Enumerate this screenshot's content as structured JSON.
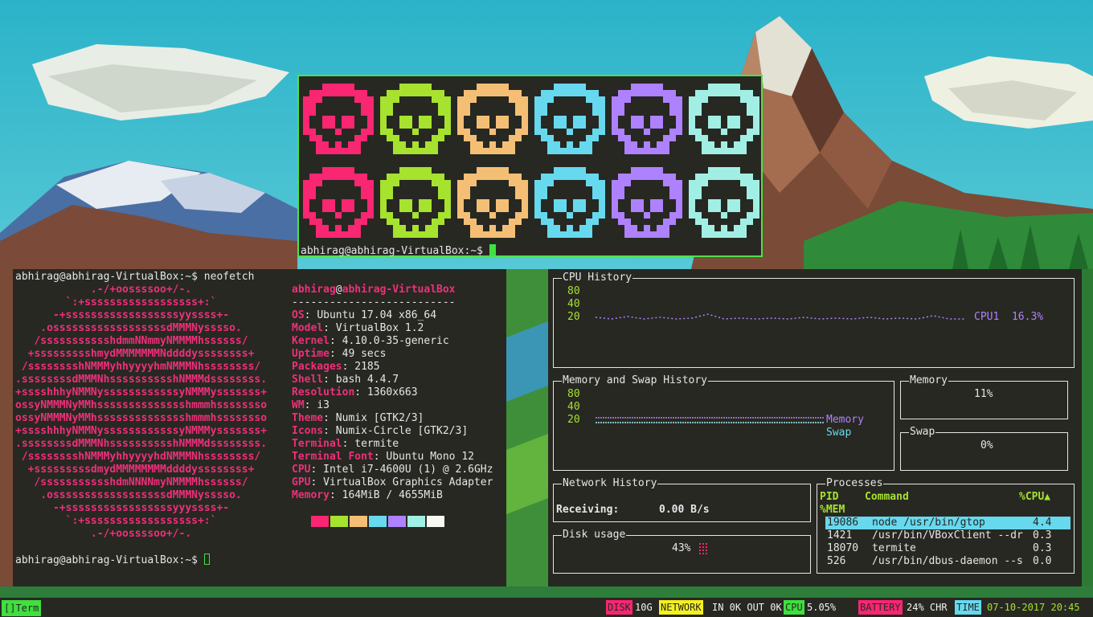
{
  "skulls": {
    "colors": [
      "#f92672",
      "#a6e22e",
      "#f4bf75",
      "#66d9ef",
      "#ae81ff",
      "#a1efe4"
    ],
    "prompt": "abhirag@abhirag-VirtualBox:~$ "
  },
  "neofetch": {
    "command_line": "abhirag@abhirag-VirtualBox:~$ neofetch",
    "user": "abhirag",
    "at": "@",
    "host": "abhirag-VirtualBox",
    "separator": "--------------------------",
    "logo_lines": [
      "            .-/+oossssoo+/-.",
      "        `:+ssssssssssssssssss+:`",
      "      -+ssssssssssssssssssyyssss+-",
      "    .ossssssssssssssssssdMMMNysssso.",
      "   /ssssssssssshdmmNNmmyNMMMMhssssss/",
      "  +ssssssssshmydMMMMMMMNddddyssssssss+",
      " /sssssssshNMMMyhhyyyyhmNMMMNhssssssss/",
      ".ssssssssdMMMNhsssssssssshNMMMdssssssss.",
      "+sssshhhyNMMNyssssssssssssyNMMMysssssss+",
      "ossyNMMMNyMMhsssssssssssssshmmmhssssssso",
      "ossyNMMMNyMMhsssssssssssssshmmmhssssssso",
      "+sssshhhyNMMNyssssssssssssyNMMMysssssss+",
      ".ssssssssdMMMNhsssssssssshNMMMdssssssss.",
      " /sssssssshNMMMyhhyyyyhdNMMMNhssssssss/",
      "  +sssssssssdmydMMMMMMMMddddyssssssss+",
      "   /ssssssssssshdmNNNNmyNMMMMhssssss/",
      "    .ossssssssssssssssssdMMMNysssso.",
      "      -+sssssssssssssssssyyyssss+-",
      "        `:+ssssssssssssssssss+:`",
      "            .-/+oossssoo+/-."
    ],
    "info": [
      {
        "key": "OS",
        "value": "Ubuntu 17.04 x86_64"
      },
      {
        "key": "Model",
        "value": "VirtualBox 1.2"
      },
      {
        "key": "Kernel",
        "value": "4.10.0-35-generic"
      },
      {
        "key": "Uptime",
        "value": "49 secs"
      },
      {
        "key": "Packages",
        "value": "2185"
      },
      {
        "key": "Shell",
        "value": "bash 4.4.7"
      },
      {
        "key": "Resolution",
        "value": "1360x663"
      },
      {
        "key": "WM",
        "value": "i3"
      },
      {
        "key": "Theme",
        "value": "Numix [GTK2/3]"
      },
      {
        "key": "Icons",
        "value": "Numix-Circle [GTK2/3]"
      },
      {
        "key": "Terminal",
        "value": "termite"
      },
      {
        "key": "Terminal Font",
        "value": "Ubuntu Mono 12"
      },
      {
        "key": "CPU",
        "value": "Intel i7-4600U (1) @ 2.6GHz"
      },
      {
        "key": "GPU",
        "value": "VirtualBox Graphics Adapter"
      },
      {
        "key": "Memory",
        "value": "164MiB / 4655MiB"
      }
    ],
    "palette": [
      "#f92672",
      "#a6e22e",
      "#f4bf75",
      "#66d9ef",
      "#ae81ff",
      "#a1efe4",
      "#f8f8f2"
    ],
    "prompt": "abhirag@abhirag-VirtualBox:~$ "
  },
  "gtop": {
    "cpu_history": {
      "title": "CPU History",
      "y_ticks": [
        "80",
        "40",
        "20"
      ],
      "legend": "CPU1",
      "value": "16.3%"
    },
    "mem_history": {
      "title": "Memory and Swap History",
      "y_ticks": [
        "80",
        "40",
        "20"
      ],
      "legend_memory": "Memory",
      "legend_swap": "Swap"
    },
    "memory": {
      "title": "Memory",
      "value": "11%"
    },
    "swap": {
      "title": "Swap",
      "value": "0%"
    },
    "network": {
      "title": "Network History",
      "receiving_label": "Receiving:",
      "receiving_value": "0.00 B/s"
    },
    "disk": {
      "title": "Disk usage",
      "value": "43%"
    },
    "processes": {
      "title": "Processes",
      "col_pid": "PID",
      "col_command": "Command",
      "col_cpu": "%CPU▲",
      "col_mem": "%MEM",
      "rows": [
        {
          "pid": "19086",
          "command": "node /usr/bin/gtop",
          "cpu": "4.4"
        },
        {
          "pid": "1421",
          "command": "/usr/bin/VBoxClient --dr",
          "cpu": "0.3"
        },
        {
          "pid": "18070",
          "command": "termite",
          "cpu": "0.3"
        },
        {
          "pid": "526",
          "command": "/usr/bin/dbus-daemon --s",
          "cpu": "0.0"
        }
      ]
    }
  },
  "statusbar": {
    "workspace": "[]",
    "workspace_label": "Term",
    "disk_label": "DISK",
    "disk_value": "10G",
    "network_label": "NETWORK",
    "network_value": "IN 0K OUT 0K",
    "cpu_label": "CPU",
    "cpu_value": "5.05%",
    "battery_label": "BATTERY",
    "battery_value": "24% CHR",
    "time_label": "TIME",
    "time_value": "07-10-2017 20:45"
  }
}
